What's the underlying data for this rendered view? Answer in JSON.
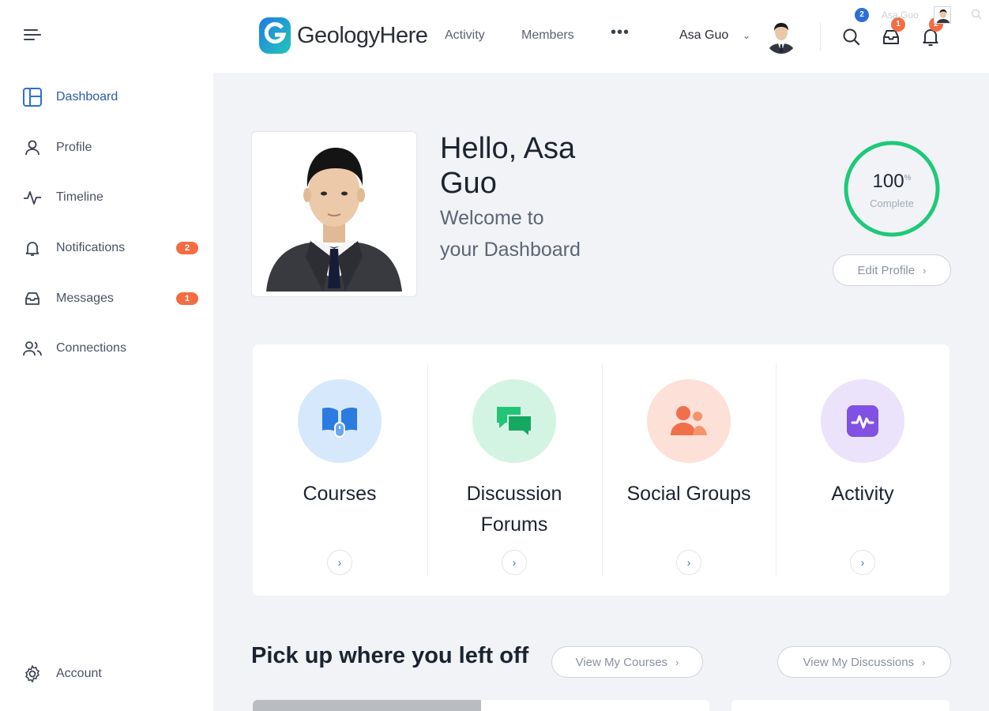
{
  "brand": {
    "name": "GeologyHere",
    "accent": "#2b6fd6"
  },
  "sidebar": {
    "items": [
      {
        "label": "Dashboard",
        "icon": "dashboard-icon",
        "active": true
      },
      {
        "label": "Profile",
        "icon": "person-icon"
      },
      {
        "label": "Timeline",
        "icon": "pulse-icon"
      },
      {
        "label": "Notifications",
        "icon": "bell-icon",
        "badge": "2"
      },
      {
        "label": "Messages",
        "icon": "inbox-icon",
        "badge": "1"
      },
      {
        "label": "Connections",
        "icon": "people-icon"
      }
    ],
    "footer": {
      "label": "Account",
      "icon": "gear-icon"
    }
  },
  "header": {
    "links": [
      "Activity",
      "Members"
    ],
    "more": "•••",
    "user_name": "Asa Guo",
    "ghost_name": "Asa Guo",
    "badges": {
      "search": "2",
      "inbox": "1",
      "bell": "2"
    }
  },
  "profile": {
    "greeting": "Hello, Asa Guo",
    "welcome": "Welcome to your Dashboard",
    "completion": {
      "value": "100",
      "unit": "%",
      "label": "Complete",
      "fraction": 1.0
    },
    "edit_button": "Edit Profile"
  },
  "quick_links": [
    {
      "label": "Courses",
      "icon": "book-icon",
      "bg": "#d6e8fb",
      "fg": "#2b7be0"
    },
    {
      "label": "Discussion Forums",
      "icon": "chat-icon",
      "bg": "#d4f4e3",
      "fg": "#22c476"
    },
    {
      "label": "Social Groups",
      "icon": "group-icon",
      "bg": "#fde0d8",
      "fg": "#f0704a"
    },
    {
      "label": "Activity",
      "icon": "activity-icon",
      "bg": "#ebe3fb",
      "fg": "#8151e4"
    }
  ],
  "resume": {
    "title": "Pick up where you left off",
    "courses_button": "View My Courses",
    "discussions_button": "View My Discussions"
  },
  "colors": {
    "badge": "#f36c42",
    "progress": "#1ec97a",
    "search_badge": "#2b6fd6"
  }
}
